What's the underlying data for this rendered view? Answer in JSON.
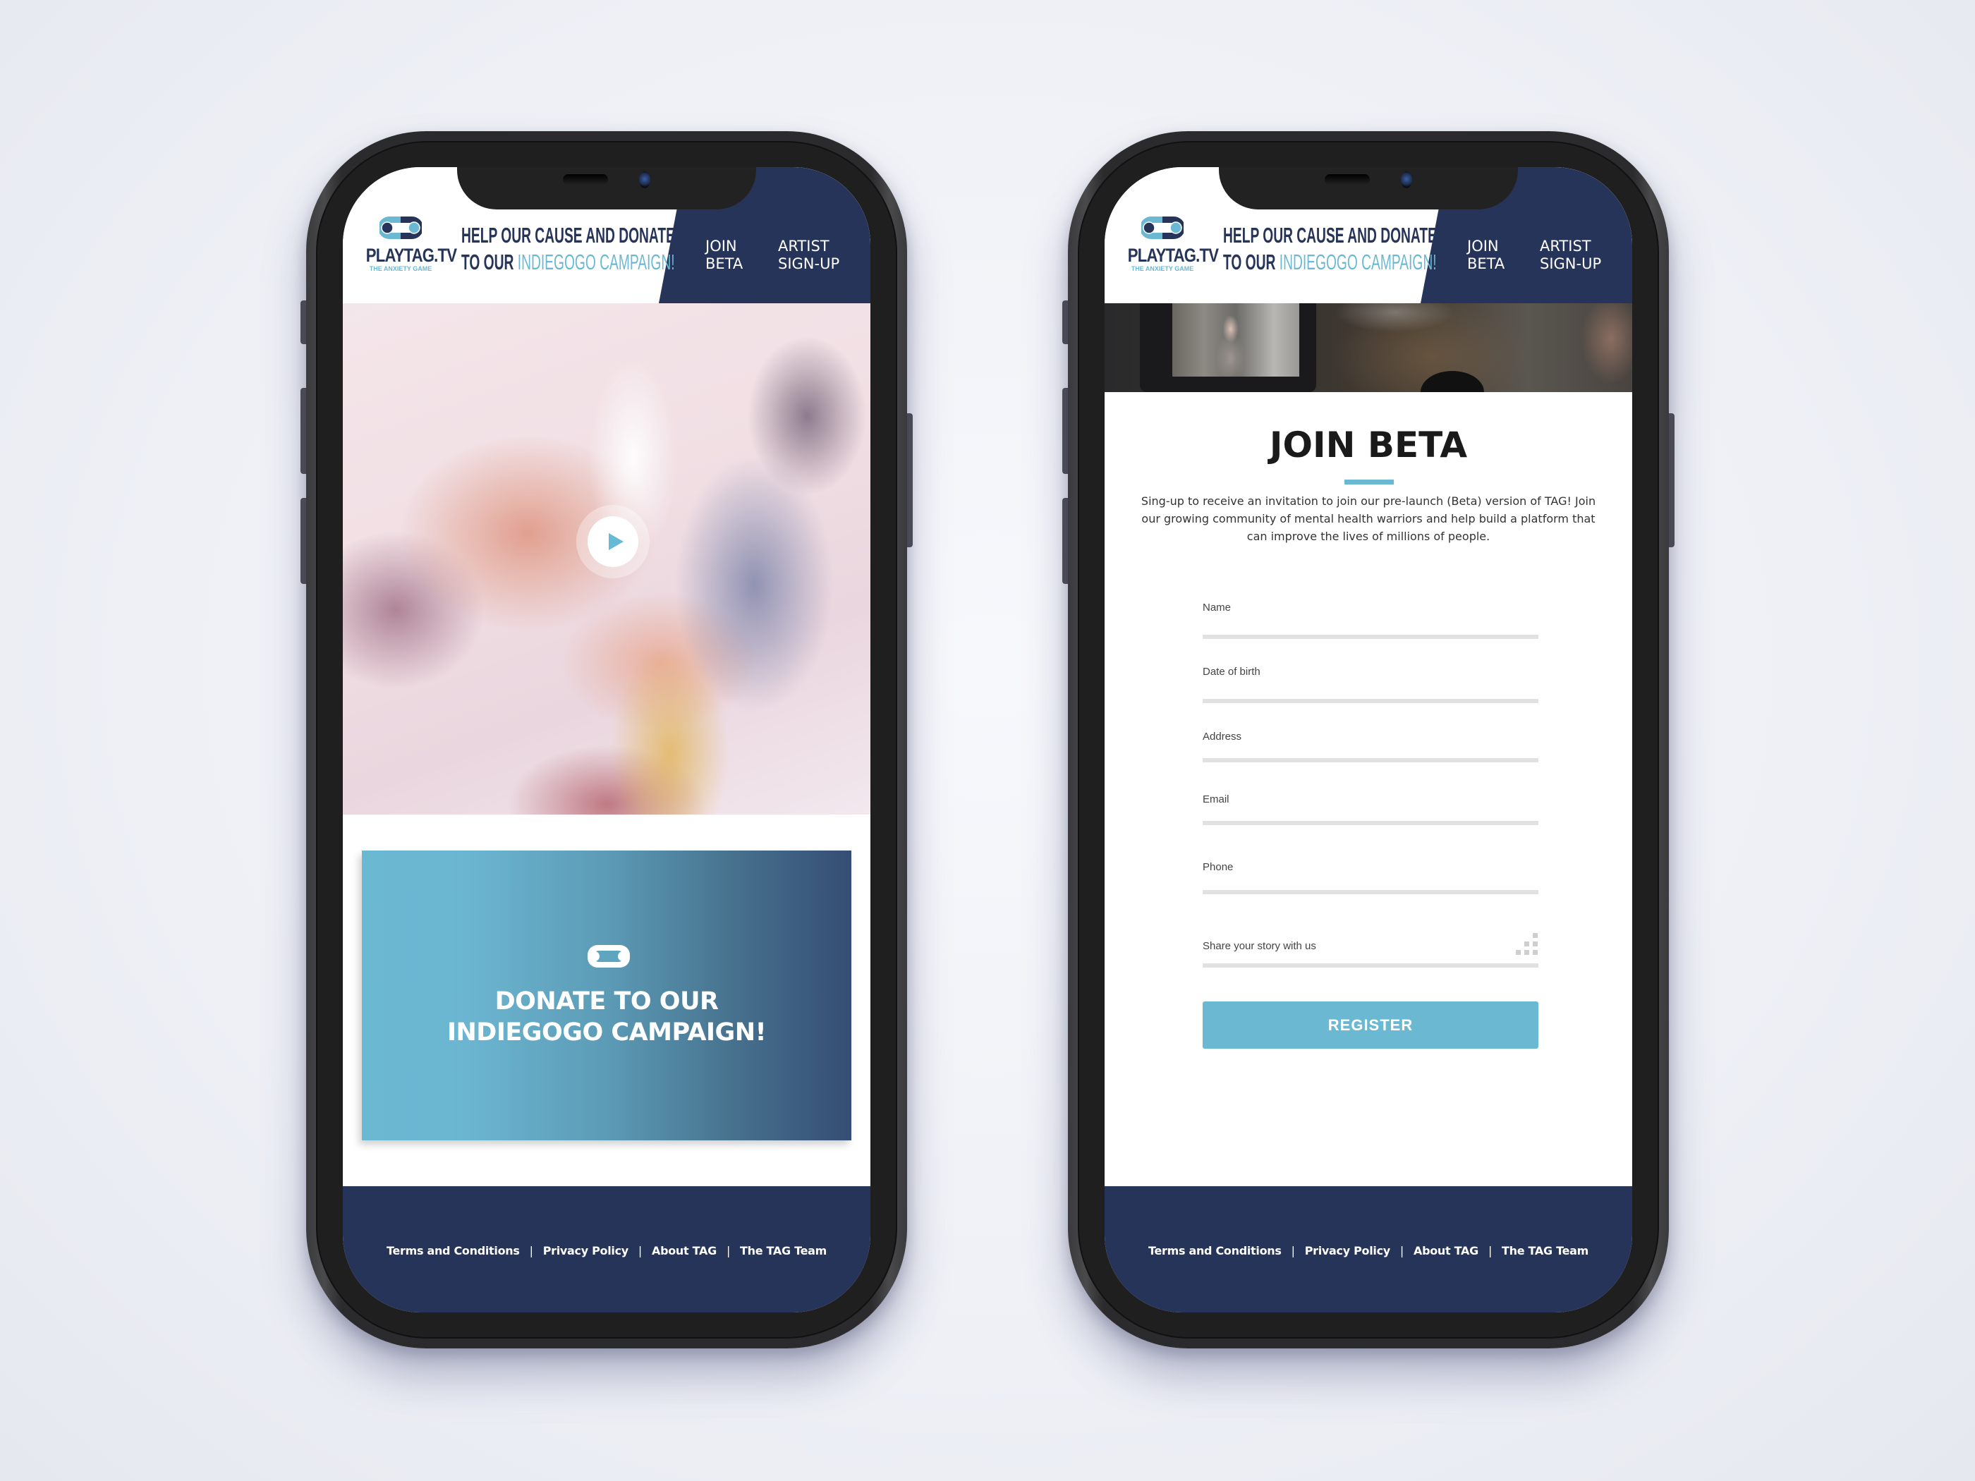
{
  "brand": {
    "logo_name": "PLAYTAG.TV",
    "logo_tagline": "THE ANXIETY GAME",
    "colors": {
      "navy": "#263459",
      "light_blue": "#6bb8d3",
      "white": "#ffffff",
      "field_line": "#e1e1e1"
    }
  },
  "header": {
    "promo_line1": "HELP OUR CAUSE AND DONATE",
    "promo_line2_prefix": "TO OUR ",
    "promo_line2_highlight": "INDIEGOGO CAMPAIGN!",
    "nav": [
      {
        "line1": "JOIN",
        "line2": "BETA"
      },
      {
        "line1": "ARTIST",
        "line2": "SIGN-UP"
      }
    ]
  },
  "home_screen": {
    "play_icon": "play-icon",
    "donate_card": {
      "icon": "playtag-logo-icon",
      "line1": "DONATE TO OUR",
      "line2": "INDIEGOGO CAMPAIGN!"
    }
  },
  "join_screen": {
    "title": "JOIN BETA",
    "description": "Sing-up to receive an invitation to join our pre-launch (Beta) version of TAG! Join our growing community of mental health warriors and help build a platform that can improve the lives of millions of people.",
    "fields": [
      {
        "label": "Name",
        "value": ""
      },
      {
        "label": "Date of birth",
        "value": ""
      },
      {
        "label": "Address",
        "value": ""
      },
      {
        "label": "Email",
        "value": ""
      },
      {
        "label": "Phone",
        "value": ""
      },
      {
        "label": "Share your story with us",
        "value": ""
      }
    ],
    "register_label": "REGISTER"
  },
  "footer": {
    "links": [
      "Terms and Conditions",
      "Privacy Policy",
      "About TAG",
      "The TAG Team"
    ],
    "separator": "|"
  }
}
